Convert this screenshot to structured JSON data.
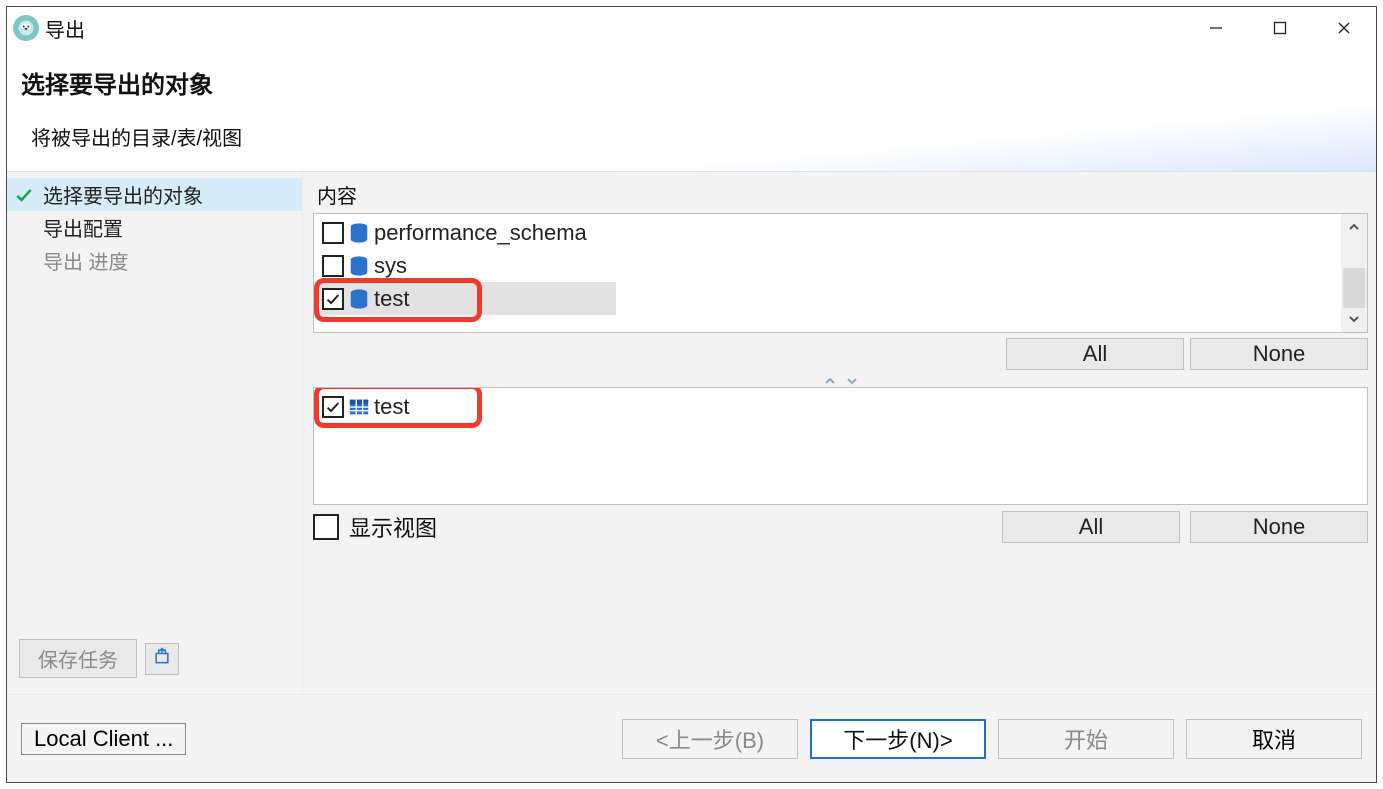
{
  "window": {
    "title": "导出"
  },
  "header": {
    "title": "选择要导出的对象",
    "subtitle": "将被导出的目录/表/视图"
  },
  "sidebar": {
    "steps": [
      {
        "label": "选择要导出的对象",
        "active": true,
        "checked": true,
        "disabled": false
      },
      {
        "label": "导出配置",
        "active": false,
        "checked": false,
        "disabled": false
      },
      {
        "label": "导出 进度",
        "active": false,
        "checked": false,
        "disabled": true
      }
    ],
    "save_task_label": "保存任务"
  },
  "main": {
    "content_label": "内容",
    "db_items": [
      {
        "name": "performance_schema",
        "checked": false,
        "selected": false
      },
      {
        "name": "sys",
        "checked": false,
        "selected": false
      },
      {
        "name": "test",
        "checked": true,
        "selected": true
      }
    ],
    "table_items": [
      {
        "name": "test",
        "checked": true
      }
    ],
    "all_label": "All",
    "none_label": "None",
    "show_views_label": "显示视图"
  },
  "bottom": {
    "local_client_label": "Local Client ...",
    "back_label": "<上一步(B)",
    "next_label": "下一步(N)>",
    "start_label": "开始",
    "cancel_label": "取消"
  }
}
